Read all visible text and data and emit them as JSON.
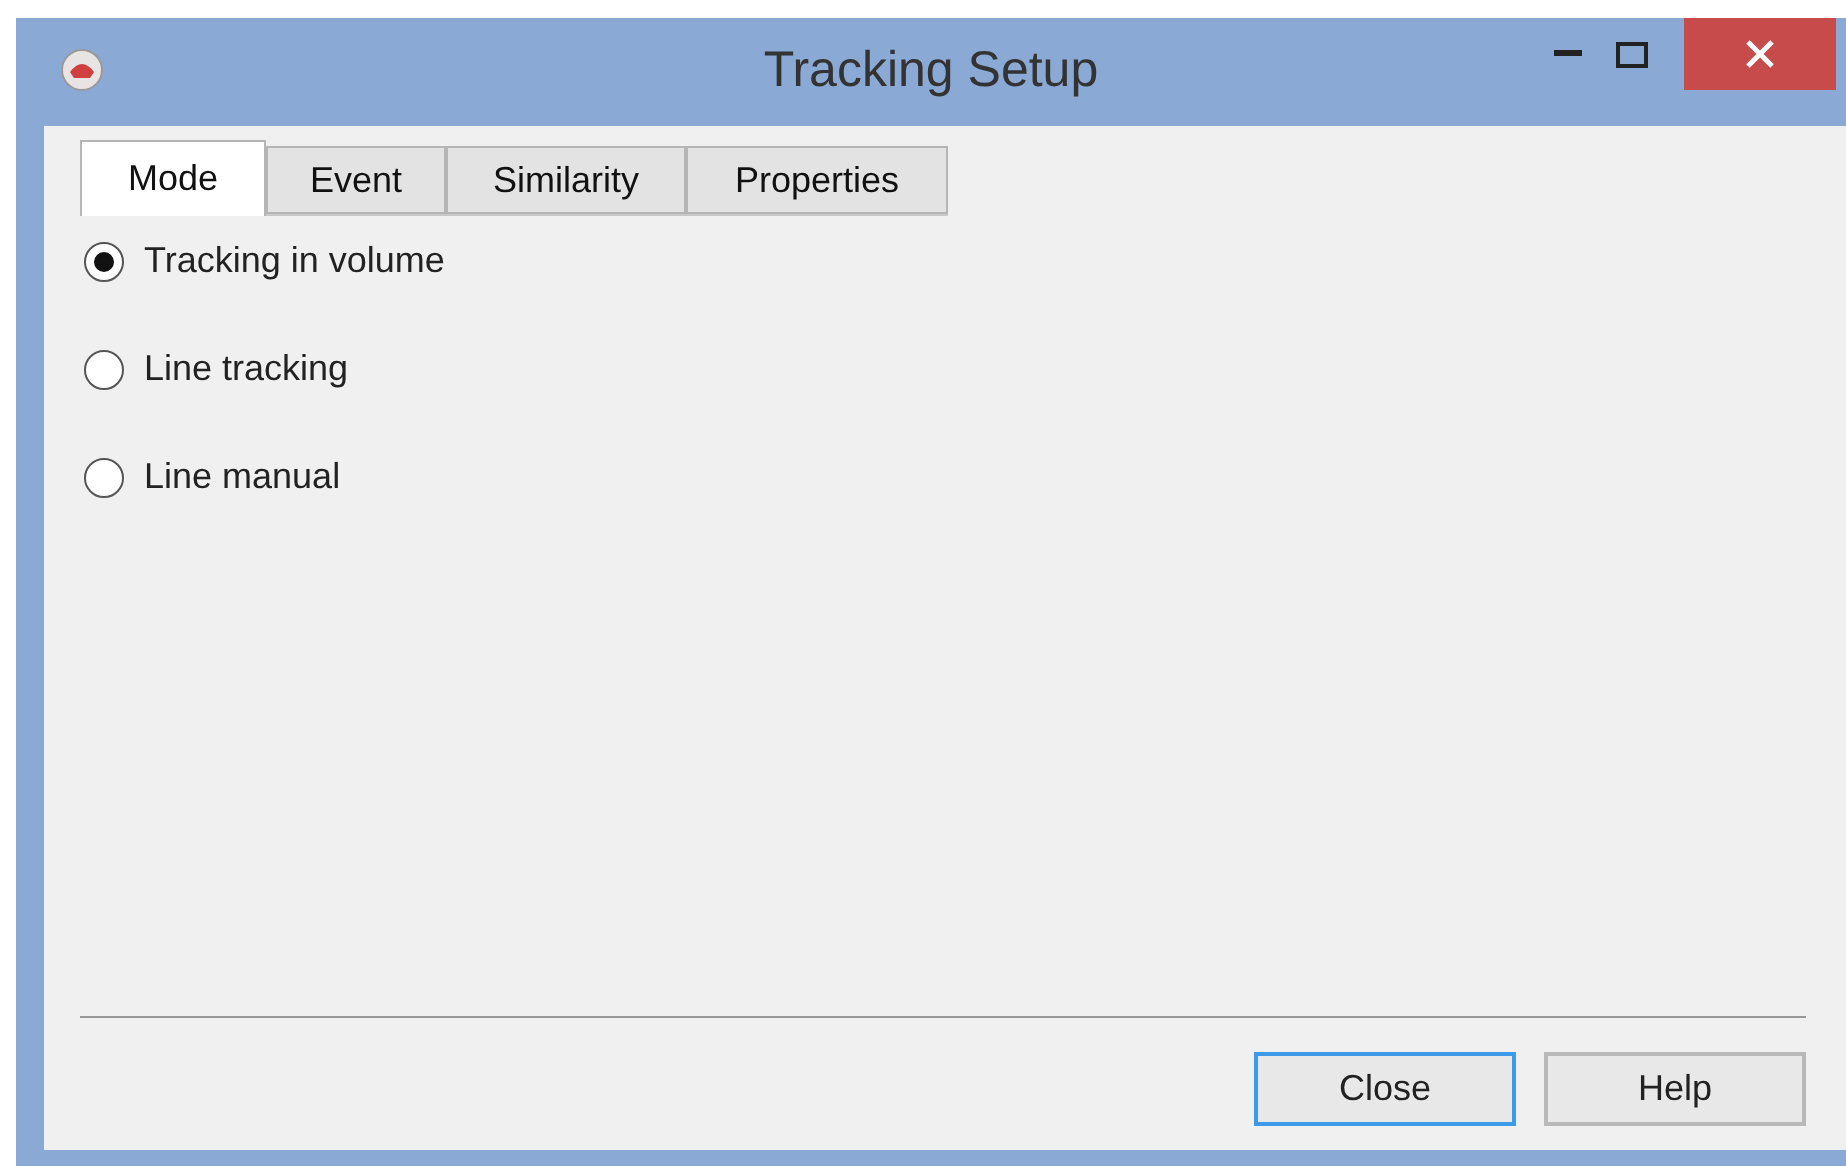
{
  "window": {
    "title": "Tracking Setup"
  },
  "tabs": [
    {
      "label": "Mode",
      "selected": true
    },
    {
      "label": "Event",
      "selected": false
    },
    {
      "label": "Similarity",
      "selected": false
    },
    {
      "label": "Properties",
      "selected": false
    }
  ],
  "options": [
    {
      "label": "Tracking in volume",
      "selected": true
    },
    {
      "label": "Line tracking",
      "selected": false
    },
    {
      "label": "Line manual",
      "selected": false
    }
  ],
  "buttons": [
    {
      "label": "Close",
      "default": true
    },
    {
      "label": "Help",
      "default": false
    }
  ]
}
